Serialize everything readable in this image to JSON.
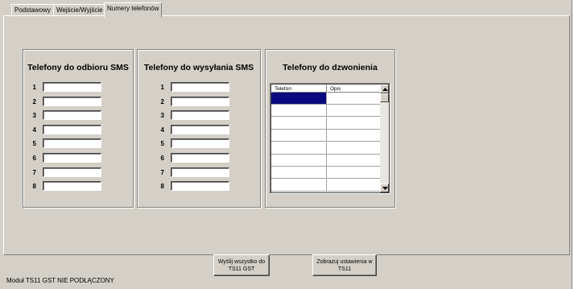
{
  "tabs": [
    {
      "label": "Podstawowy",
      "active": false
    },
    {
      "label": "Wejście/Wyjście",
      "active": false
    },
    {
      "label": "Numery telefonów",
      "active": true
    }
  ],
  "sms_receive": {
    "title": "Telefony do odbioru SMS",
    "rows": [
      {
        "num": "1",
        "value": ""
      },
      {
        "num": "2",
        "value": ""
      },
      {
        "num": "3",
        "value": ""
      },
      {
        "num": "4",
        "value": ""
      },
      {
        "num": "5",
        "value": ""
      },
      {
        "num": "6",
        "value": ""
      },
      {
        "num": "7",
        "value": ""
      },
      {
        "num": "8",
        "value": ""
      }
    ]
  },
  "sms_send": {
    "title": "Telefony do wysyłania SMS",
    "rows": [
      {
        "num": "1",
        "value": ""
      },
      {
        "num": "2",
        "value": ""
      },
      {
        "num": "3",
        "value": ""
      },
      {
        "num": "4",
        "value": ""
      },
      {
        "num": "5",
        "value": ""
      },
      {
        "num": "6",
        "value": ""
      },
      {
        "num": "7",
        "value": ""
      },
      {
        "num": "8",
        "value": ""
      }
    ]
  },
  "calls": {
    "title": "Telefony do dzwonienia",
    "columns": [
      "Telefon",
      "Opis"
    ],
    "row_count": 8,
    "selected_row": 0
  },
  "buttons": {
    "send_all": "Wyślij wszystko do TS11 GST",
    "show_settings": "Zobrazuj ustawienia w TS11"
  },
  "status": "Moduł TS11 GST NIE PODŁĄCZONY"
}
